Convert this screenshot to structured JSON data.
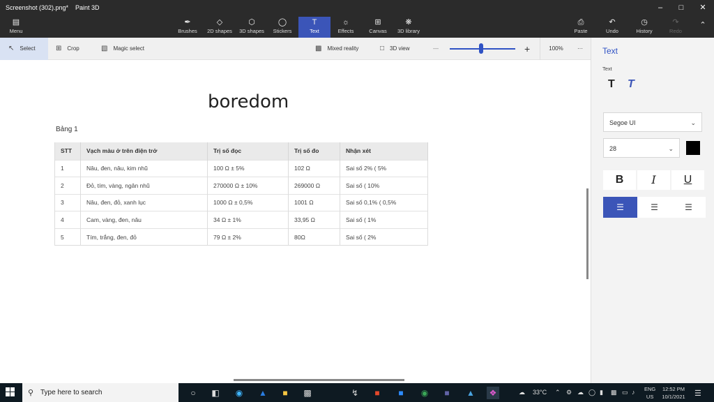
{
  "window": {
    "title": "Screenshot (302).png*",
    "app_name": "Paint 3D"
  },
  "toolbar": {
    "menu": "Menu",
    "tools": [
      "Brushes",
      "2D shapes",
      "3D shapes",
      "Stickers",
      "Text",
      "Effects",
      "Canvas",
      "3D library"
    ],
    "active_tool": "Text",
    "paste": "Paste",
    "undo": "Undo",
    "history": "History",
    "redo": "Redo"
  },
  "subbar": {
    "select": "Select",
    "crop": "Crop",
    "magic_select": "Magic select",
    "mixed_reality": "Mixed reality",
    "view_3d": "3D view",
    "zoom": "100%",
    "zoom_fraction": 0.48,
    "more": "···"
  },
  "document": {
    "title": "boredom",
    "caption": "Bảng 1",
    "table": {
      "headers": [
        "STT",
        "Vạch màu ở trên điện trở",
        "Trị số đọc",
        "Trị số đo",
        "Nhận xét"
      ],
      "rows": [
        [
          "1",
          "Nâu, đen, nâu, kim nhũ",
          "100 Ω ± 5%",
          "102 Ω",
          "Sai số 2% ( 5%"
        ],
        [
          "2",
          "Đỏ, tím, vàng, ngân nhũ",
          "270000 Ω ± 10%",
          "269000 Ω",
          "Sai số ( 10%"
        ],
        [
          "3",
          "Nâu, đen, đỏ, xanh lục",
          "1000 Ω ± 0,5%",
          "1001 Ω",
          "Sai số 0,1% ( 0,5%"
        ],
        [
          "4",
          "Cam, vàng, đen, nâu",
          "34 Ω ± 1%",
          "33,95 Ω",
          "Sai số ( 1%"
        ],
        [
          "5",
          "Tím, trắng, đen, đỏ",
          "79 Ω ± 2%",
          "80Ω",
          "Sai số ( 2%"
        ]
      ]
    }
  },
  "panel": {
    "title": "Text",
    "subtitle": "Text",
    "font": "Segoe UI",
    "size": "28",
    "color": "#000000",
    "bold": "B",
    "italic": "I",
    "underline": "U"
  },
  "taskbar": {
    "search_placeholder": "Type here to search",
    "temperature": "33°C",
    "lang_top": "ENG",
    "lang_bottom": "US",
    "time": "12:52 PM",
    "date": "10/1/2021"
  },
  "colors": {
    "accent": "#3b55b8",
    "dark_bar": "#2b2b2b",
    "taskbar": "#0e1a22"
  }
}
